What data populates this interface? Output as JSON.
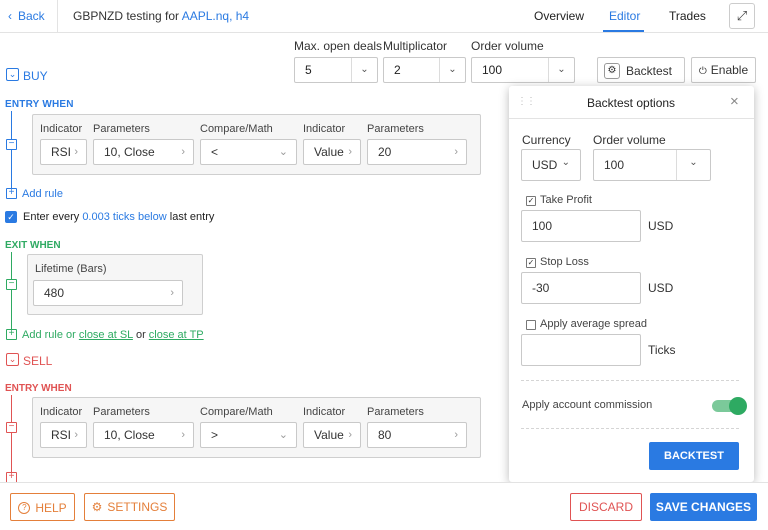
{
  "header": {
    "back_label": "Back",
    "title_prefix": "GBPNZD testing for ",
    "title_link": "AAPL.nq, h4",
    "tabs": [
      "Overview",
      "Editor",
      "Trades"
    ],
    "active_tab": "Editor"
  },
  "toolbar": {
    "max_open_deals_label": "Max. open deals",
    "max_open_deals_value": "5",
    "multiplicator_label": "Multiplicator",
    "multiplicator_value": "2",
    "order_volume_label": "Order volume",
    "order_volume_value": "100",
    "backtest_label": "Backtest",
    "enable_label": "Enable"
  },
  "buy": {
    "section_label": "BUY",
    "entry_when_label": "ENTRY WHEN",
    "rule_headers": [
      "Indicator",
      "Parameters",
      "Compare/Math",
      "Indicator",
      "Parameters"
    ],
    "rule": {
      "indicator": "RSI",
      "parameters": "10, Close",
      "compare": "<",
      "indicator2": "Value",
      "parameters2": "20"
    },
    "add_rule_label": "Add rule",
    "enter_every_prefix": "Enter every ",
    "enter_every_link": "0.003 ticks below",
    "enter_every_suffix": " last entry",
    "exit_when_label": "EXIT WHEN",
    "lifetime_label": "Lifetime (Bars)",
    "lifetime_value": "480",
    "exit_add_rule_label": "Add rule or ",
    "close_sl_label": "close at SL",
    "or_label": " or ",
    "close_tp_label": "close at TP"
  },
  "sell": {
    "section_label": "SELL",
    "entry_when_label": "ENTRY WHEN",
    "rule_headers": [
      "Indicator",
      "Parameters",
      "Compare/Math",
      "Indicator",
      "Parameters"
    ],
    "rule": {
      "indicator": "RSI",
      "parameters": "10, Close",
      "compare": ">",
      "indicator2": "Value",
      "parameters2": "80"
    }
  },
  "backtest_panel": {
    "title": "Backtest options",
    "currency_label": "Currency",
    "currency_value": "USD",
    "order_volume_label": "Order volume",
    "order_volume_value": "100",
    "take_profit_label": "Take Profit",
    "take_profit_checked": true,
    "take_profit_value": "100",
    "take_profit_unit": "USD",
    "stop_loss_label": "Stop Loss",
    "stop_loss_checked": true,
    "stop_loss_value": "-30",
    "stop_loss_unit": "USD",
    "apply_spread_label": "Apply average spread",
    "apply_spread_checked": false,
    "spread_value": "",
    "spread_unit": "Ticks",
    "commission_label": "Apply account commission",
    "commission_enabled": true,
    "backtest_button": "BACKTEST"
  },
  "footer": {
    "help_label": "HELP",
    "settings_label": "SETTINGS",
    "discard_label": "DISCARD",
    "save_label": "SAVE CHANGES"
  },
  "colors": {
    "accent": "#2a7ae2",
    "buy": "#2a7ae2",
    "exit": "#2eaa62",
    "sell": "#e05353",
    "orange": "#e47f3a"
  }
}
